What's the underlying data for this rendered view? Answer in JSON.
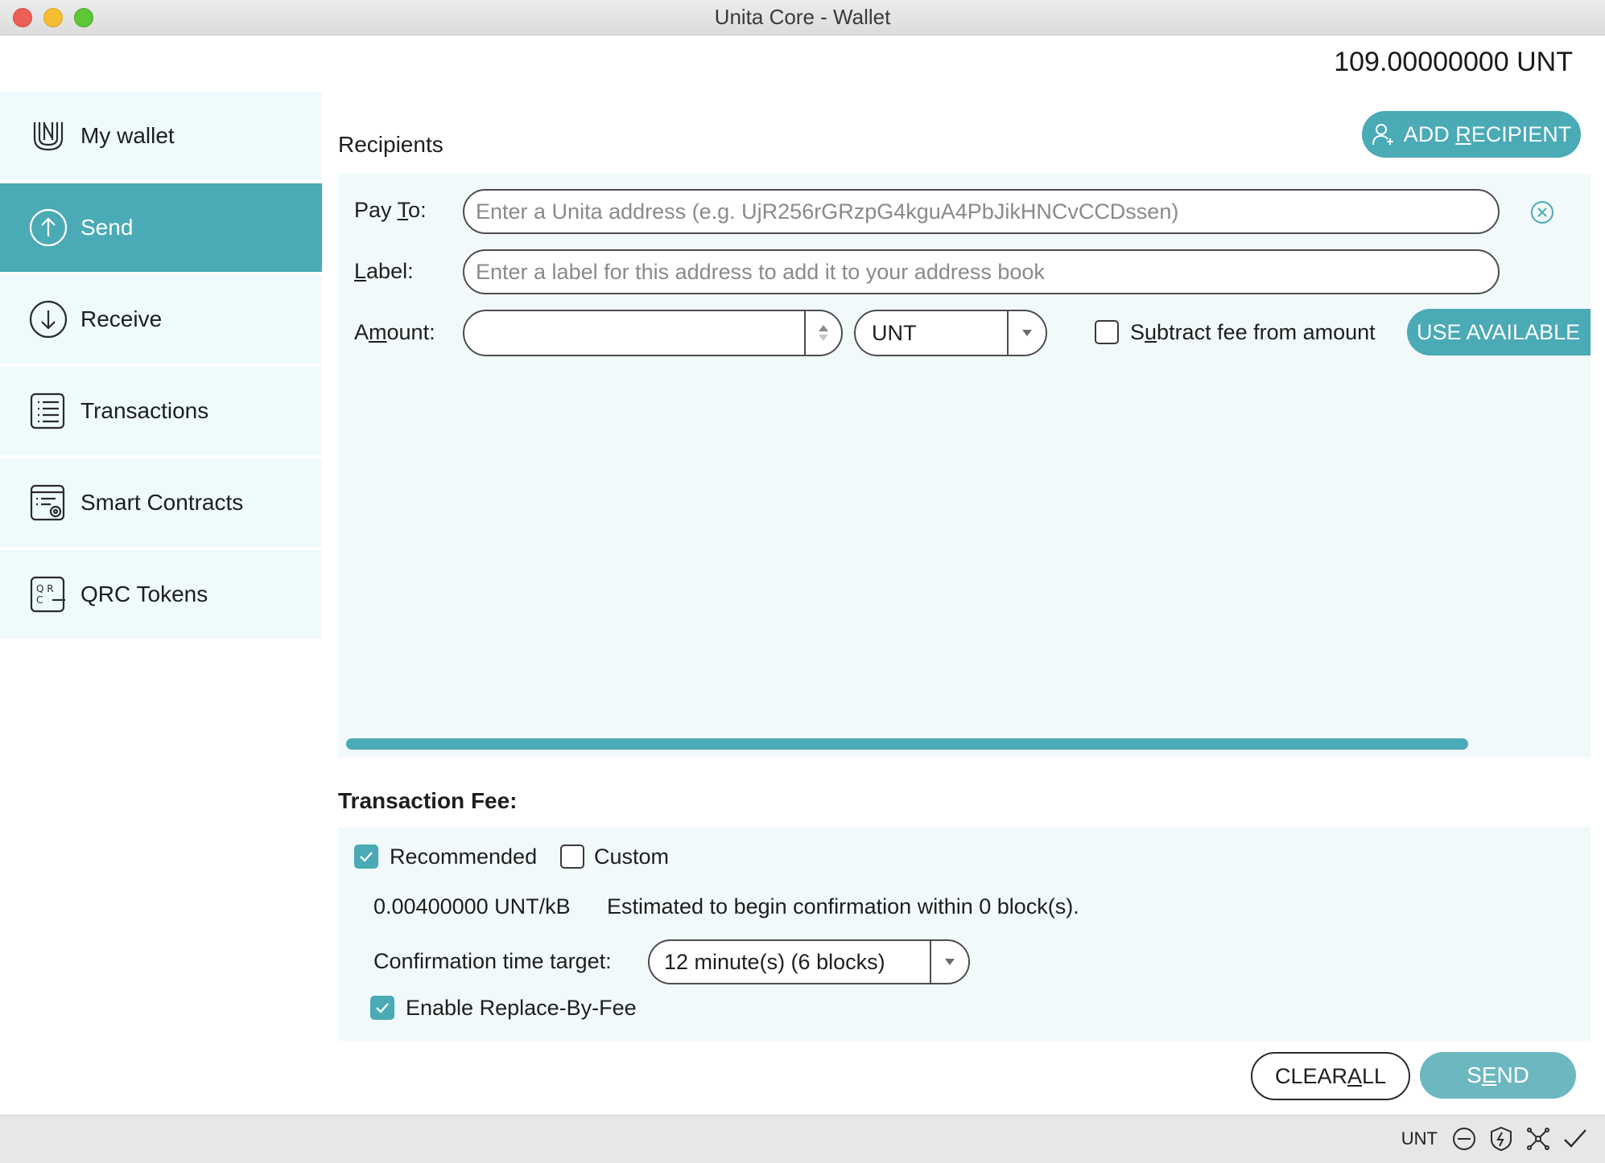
{
  "window": {
    "title": "Unita Core - Wallet"
  },
  "balance": "109.00000000 UNT",
  "sidebar": {
    "items": [
      {
        "label": "My wallet",
        "icon": "wallet-icon",
        "active": false
      },
      {
        "label": "Send",
        "icon": "send-arrow-icon",
        "active": true
      },
      {
        "label": "Receive",
        "icon": "receive-arrow-icon",
        "active": false
      },
      {
        "label": "Transactions",
        "icon": "transactions-list-icon",
        "active": false
      },
      {
        "label": "Smart Contracts",
        "icon": "smart-contract-icon",
        "active": false
      },
      {
        "label": "QRC Tokens",
        "icon": "qrc-token-icon",
        "active": false
      }
    ]
  },
  "recipients": {
    "title": "Recipients",
    "add_button": {
      "label_pre": "ADD ",
      "label_ul": "R",
      "label_post": "ECIPIENT"
    },
    "pay_to": {
      "label_pre": "Pay ",
      "label_ul": "T",
      "label_post": "o:",
      "value": "",
      "placeholder": "Enter a Unita address (e.g. UjR256rGRzpG4kguA4PbJikHNCvCCDssen)"
    },
    "label": {
      "label_ul": "L",
      "label_post": "abel:",
      "value": "",
      "placeholder": "Enter a label for this address to add it to your address book"
    },
    "amount": {
      "label_pre": "A",
      "label_ul": "m",
      "label_post": "ount:",
      "value": "",
      "unit": "UNT"
    },
    "subtract_fee": {
      "label_pre": "S",
      "label_ul": "u",
      "label_post": "btract fee from amount",
      "checked": false
    },
    "use_available": "USE AVAILABLE"
  },
  "fee": {
    "title": "Transaction Fee:",
    "recommended": {
      "label": "Recommended",
      "checked": true
    },
    "custom": {
      "label": "Custom",
      "checked": false
    },
    "rate": "0.00400000 UNT/kB",
    "estimate": "Estimated to begin confirmation within 0 block(s).",
    "confirmation_label": "Confirmation time target:",
    "confirmation_value": "12 minute(s) (6 blocks)",
    "rbf": {
      "label": "Enable Replace-By-Fee",
      "checked": true
    }
  },
  "actions": {
    "clear_all": {
      "label_pre": "CLEAR ",
      "label_ul": "A",
      "label_post": "LL"
    },
    "send": {
      "label_pre": "S",
      "label_ul": "E",
      "label_post": "ND"
    }
  },
  "statusbar": {
    "unit": "UNT"
  },
  "colors": {
    "accent": "#4aaab6",
    "panel": "#f1f9fa",
    "sidebar": "#eefafb",
    "send_button": "#6db7c1"
  }
}
